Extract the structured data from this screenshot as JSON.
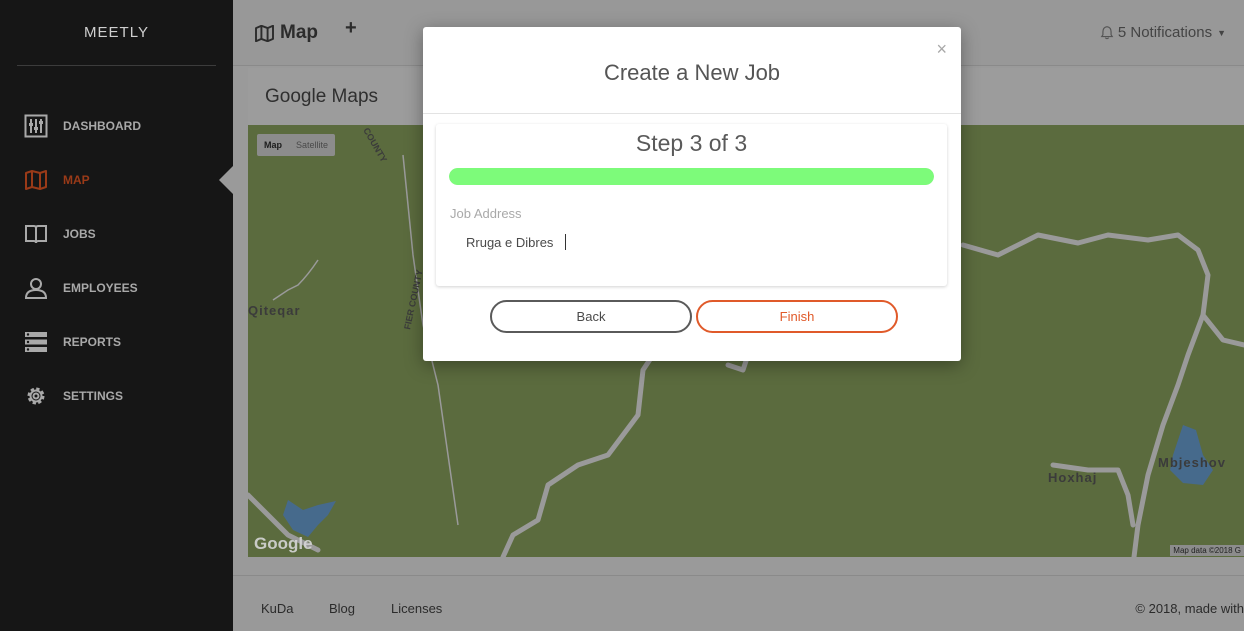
{
  "app": {
    "brand": "MEETLY"
  },
  "sidebar": {
    "items": [
      {
        "label": "DASHBOARD",
        "icon": "dashboard-icon",
        "active": false
      },
      {
        "label": "MAP",
        "icon": "map-icon",
        "active": true
      },
      {
        "label": "JOBS",
        "icon": "book-icon",
        "active": false
      },
      {
        "label": "EMPLOYEES",
        "icon": "user-icon",
        "active": false
      },
      {
        "label": "REPORTS",
        "icon": "reports-icon",
        "active": false
      },
      {
        "label": "SETTINGS",
        "icon": "gear-icon",
        "active": false
      }
    ]
  },
  "header": {
    "title": "Map",
    "add_label": "+",
    "notifications": "5 Notifications"
  },
  "card": {
    "title": "Google Maps"
  },
  "map": {
    "type_map": "Map",
    "type_satellite": "Satellite",
    "attribution": "Map data ©2018 G",
    "google": "Google",
    "labels": {
      "qiteqar": "Qiteqar",
      "hoxhaj": "Hoxhaj",
      "mbjeshov": "Mbjeshov"
    }
  },
  "modal": {
    "title": "Create a New Job",
    "close": "×",
    "step_text": "Step 3 of 3",
    "progress_percent": 100,
    "field_label": "Job Address",
    "field_value": "Rruga e Dibres",
    "back_label": "Back",
    "finish_label": "Finish"
  },
  "footer": {
    "links": [
      "KuDa",
      "Blog",
      "Licenses"
    ],
    "copyright": "© 2018, made with"
  },
  "colors": {
    "accent": "#e05a2a",
    "progress": "#7dfb7a",
    "sidebar": "#161616"
  }
}
